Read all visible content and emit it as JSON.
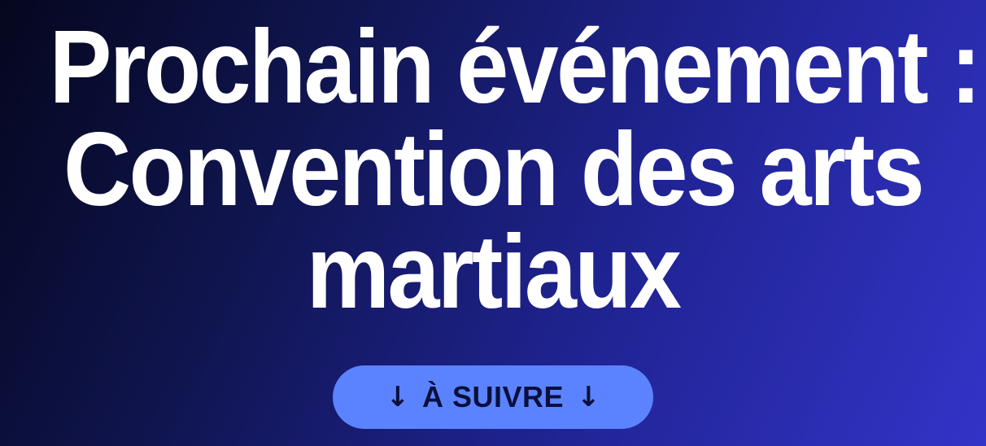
{
  "hero": {
    "title_lines": [
      "Prochain événement :",
      "Convention des arts",
      "martiaux"
    ],
    "cta": {
      "label": "À SUIVRE",
      "icon_left": "down-arrow-icon",
      "icon_right": "down-arrow-icon",
      "glyph_left": "↓",
      "glyph_right": "↓"
    }
  },
  "colors": {
    "background_start": "#05071e",
    "background_end": "#3334c8",
    "title_text": "#ffffff",
    "cta_background": "#5b83ff",
    "cta_text": "#0a0f3d"
  }
}
